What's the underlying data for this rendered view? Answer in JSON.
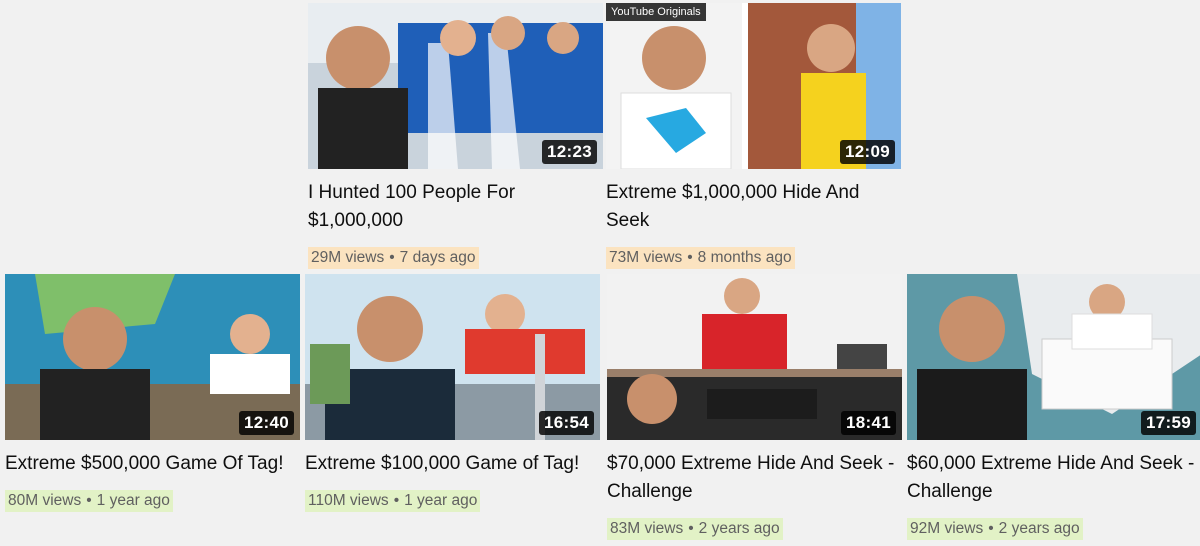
{
  "videos": [
    {
      "title": "I Hunted 100 People For $1,000,000",
      "duration": "12:23",
      "views": "29M views",
      "age": "7 days ago",
      "badge": ""
    },
    {
      "title": "Extreme $1,000,000 Hide And Seek",
      "duration": "12:09",
      "views": "73M views",
      "age": "8 months ago",
      "badge": "YouTube Originals"
    },
    {
      "title": "Extreme $500,000 Game Of Tag!",
      "duration": "12:40",
      "views": "80M views",
      "age": "1 year ago",
      "badge": ""
    },
    {
      "title": "Extreme $100,000 Game of Tag!",
      "duration": "16:54",
      "views": "110M views",
      "age": "1 year ago",
      "badge": ""
    },
    {
      "title": "$70,000 Extreme Hide And Seek - Challenge",
      "duration": "18:41",
      "views": "83M views",
      "age": "2 years ago",
      "badge": ""
    },
    {
      "title": "$60,000 Extreme Hide And Seek - Challenge",
      "duration": "17:59",
      "views": "92M views",
      "age": "2 years ago",
      "badge": ""
    }
  ],
  "separator": "•",
  "colors": {
    "highlight_recent": "#fbe3c0",
    "highlight_old": "#e2f2c6",
    "text": "#0f0f0f",
    "meta": "#606060"
  }
}
